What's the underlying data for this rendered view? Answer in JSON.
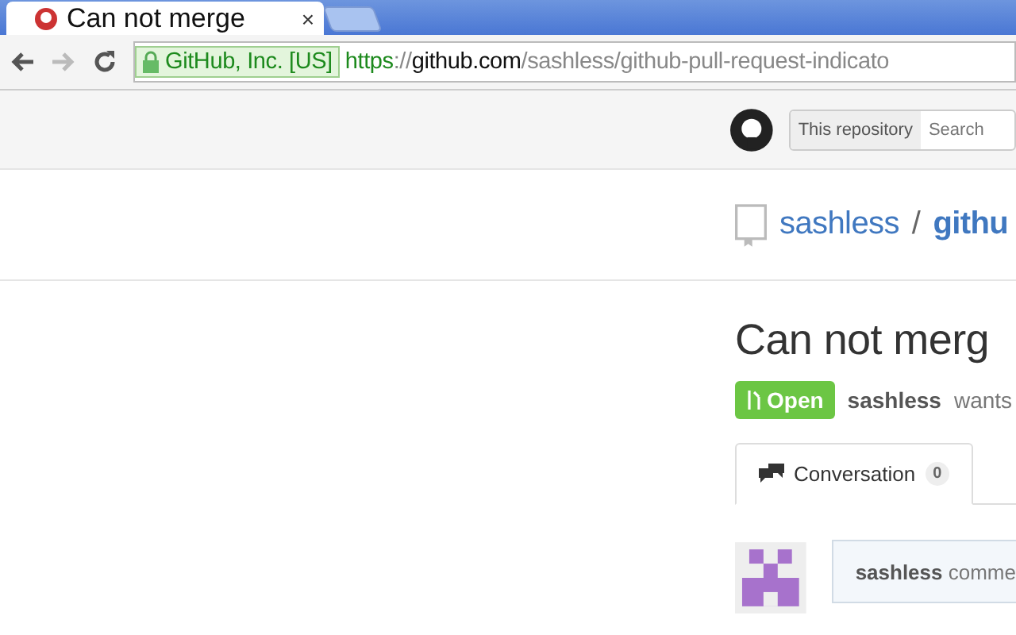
{
  "browser": {
    "tab": {
      "title": "Can not merge",
      "close": "×"
    },
    "security_label": "GitHub, Inc. [US]",
    "url": {
      "scheme": "https",
      "separator": "://",
      "host": "github.com",
      "path": "/sashless/github-pull-request-indicato"
    }
  },
  "header": {
    "scope": "This repository",
    "search_placeholder": "Search"
  },
  "repo": {
    "owner": "sashless",
    "separator": "/",
    "name": "githu"
  },
  "pull_request": {
    "title": "Can not merg",
    "state": "Open",
    "author": "sashless",
    "summary": "wants"
  },
  "tabs": [
    {
      "label": "Conversation",
      "count": "0",
      "selected": true
    }
  ],
  "comment": {
    "author": "sashless",
    "action": "comme"
  }
}
